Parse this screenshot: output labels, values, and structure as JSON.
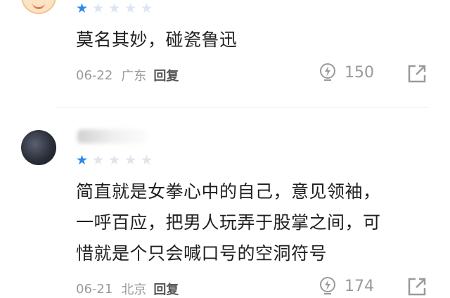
{
  "reviews": [
    {
      "stars_filled": 1,
      "stars_total": 5,
      "content": "莫名其妙，碰瓷鲁迅",
      "date": "06-22",
      "location": "广东",
      "reply_label": "回复",
      "likes": "150"
    },
    {
      "stars_filled": 1,
      "stars_total": 5,
      "content_lines": [
        "简直就是女拳心中的自己，意见领袖，",
        "一呼百应，把男人玩弄于股掌之间，可",
        "惜就是个只会喊口号的空洞符号"
      ],
      "date": "06-21",
      "location": "北京",
      "reply_label": "回复",
      "likes": "174"
    }
  ],
  "icons": {
    "star": "star-icon",
    "like": "lightbulb-icon",
    "share": "share-icon"
  },
  "colors": {
    "star_filled": "#2b8ae8",
    "star_empty": "#dde5ef",
    "meta_text": "#9a9a9a"
  }
}
